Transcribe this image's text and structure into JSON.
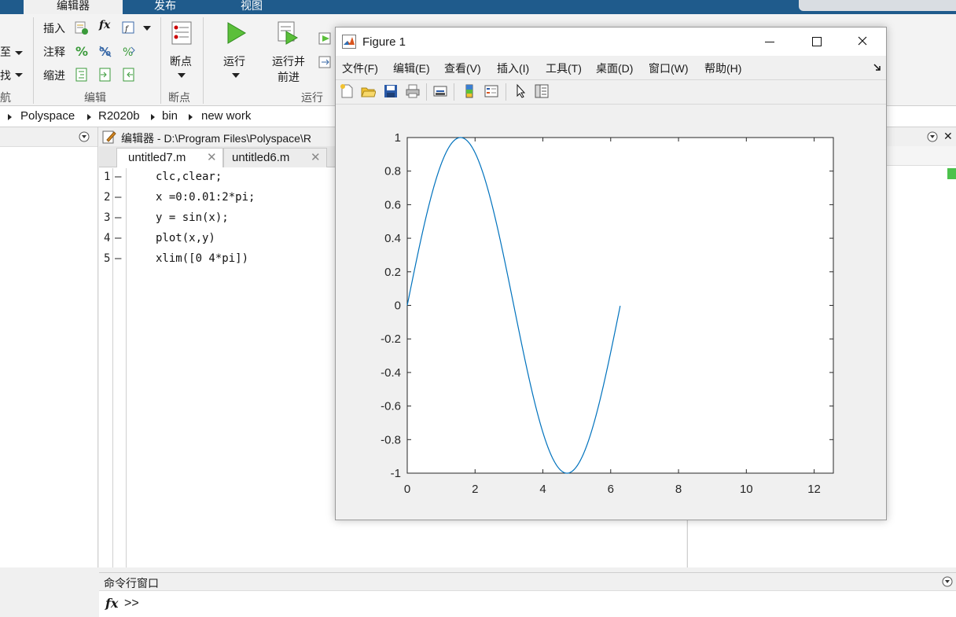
{
  "ribbon": {
    "tabs": [
      "编辑器",
      "发布",
      "视图"
    ],
    "left_fragments": [
      "至",
      "找",
      "航"
    ],
    "edit_group": {
      "insert": "插入",
      "comment": "注释",
      "indent": "缩进",
      "fx": "fx",
      "label": "编辑"
    },
    "breakpoints": {
      "button": "断点",
      "label": "断点"
    },
    "run": {
      "button": "运行",
      "advance": "运行并\n前进",
      "label": "运行"
    }
  },
  "address": {
    "crumbs": [
      "Polyspace",
      "R2020b",
      "bin",
      "new work"
    ]
  },
  "editor": {
    "title": "编辑器 - D:\\Program Files\\Polyspace\\R",
    "tabs": [
      "untitled7.m",
      "untitled6.m"
    ],
    "lines": [
      {
        "num": "1",
        "code": "clc,clear;"
      },
      {
        "num": "2",
        "code": "x =0:0.01:2*pi;"
      },
      {
        "num": "3",
        "code": "y = sin(x);"
      },
      {
        "num": "4",
        "code": "plot(x,y)"
      },
      {
        "num": "5",
        "code": "xlim([0 4*pi])"
      }
    ]
  },
  "figure": {
    "title": "Figure 1",
    "menus": [
      "文件(F)",
      "编辑(E)",
      "查看(V)",
      "插入(I)",
      "工具(T)",
      "桌面(D)",
      "窗口(W)",
      "帮助(H)"
    ],
    "colors": {
      "line": "#0072bd"
    }
  },
  "chart_data": {
    "type": "line",
    "series": [
      {
        "function": "sin",
        "x_start": 0,
        "x_end": 6.2832,
        "x_step": 0.01
      }
    ],
    "xlim": [
      0,
      12.5664
    ],
    "ylim": [
      -1,
      1
    ],
    "xticks": [
      "0",
      "2",
      "4",
      "6",
      "8",
      "10",
      "12"
    ],
    "yticks": [
      "1",
      "0.8",
      "0.6",
      "0.4",
      "0.2",
      "0",
      "-0.2",
      "-0.4",
      "-0.6",
      "-0.8",
      "-1"
    ]
  },
  "command": {
    "title": "命令行窗口",
    "fx": "fx",
    "prompt": ">>"
  }
}
